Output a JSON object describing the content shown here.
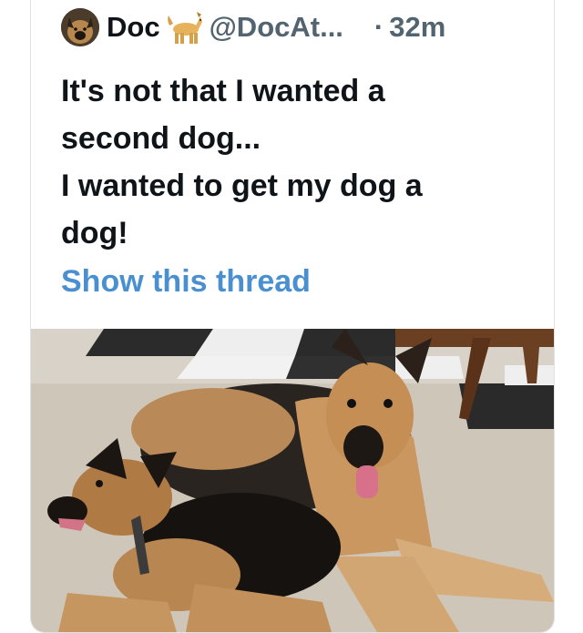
{
  "tweet": {
    "author_name": "Doc",
    "handle": "@DocAt...",
    "time_sep": "·",
    "time": "32m",
    "text_lines": [
      "It's not that I wanted a",
      "second dog...",
      "I wanted to get my dog a",
      "dog!"
    ],
    "show_thread": "Show this thread"
  },
  "icons": {
    "avatar": "dog-avatar",
    "name_emoji": "dog-emoji-icon"
  },
  "colors": {
    "text": "#0f1419",
    "muted": "#536471",
    "link": "#4a90d0"
  },
  "media": {
    "subject": "two german shepherd dogs lying on carpet"
  }
}
